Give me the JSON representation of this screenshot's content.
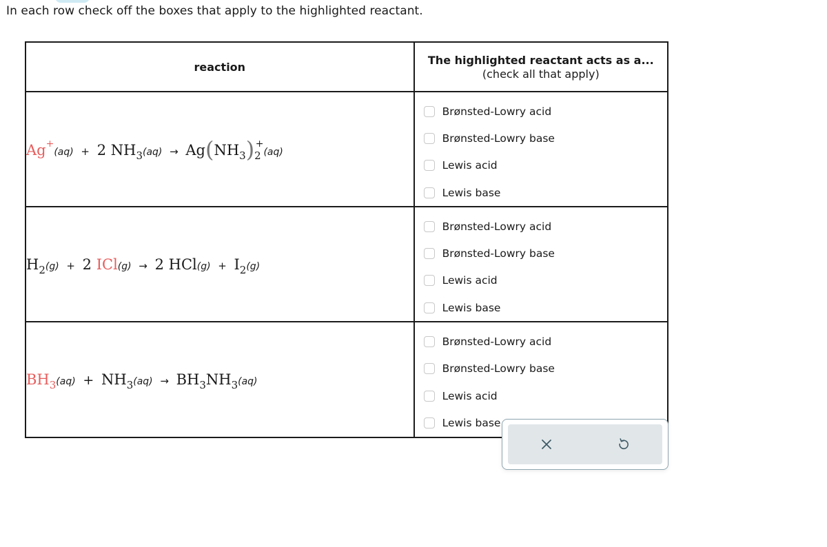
{
  "instructions": "In each row check off the boxes that apply to the highlighted reactant.",
  "table": {
    "headers": {
      "reaction": "reaction",
      "options_title": "The highlighted reactant acts as a...",
      "options_subtitle": "(check all that apply)"
    },
    "highlight_color": "#e85c5c",
    "rows": [
      {
        "equation": {
          "r1": "Ag",
          "r1_charge": "+",
          "r1_phase": "(aq)",
          "plus": "+",
          "r2_coef": "2",
          "r2": "NH",
          "r2_sub": "3",
          "r2_phase": "(aq)",
          "arrow": "→",
          "p1": "Ag",
          "p1_lparen": "(",
          "p1_inner": "NH",
          "p1_inner_sub": "3",
          "p1_rparen": ")",
          "p1_sub": "2",
          "p1_charge": "+",
          "p1_phase": "(aq)"
        },
        "highlighted": "Ag+",
        "options": [
          {
            "label": "Brønsted-Lowry acid",
            "checked": false
          },
          {
            "label": "Brønsted-Lowry base",
            "checked": false
          },
          {
            "label": "Lewis acid",
            "checked": false
          },
          {
            "label": "Lewis base",
            "checked": false
          }
        ]
      },
      {
        "equation": {
          "r1": "H",
          "r1_sub": "2",
          "r1_phase": "(g)",
          "plus": "+",
          "r2_coef": "2",
          "r2": "ICl",
          "r2_phase": "(g)",
          "arrow": "→",
          "p1_coef": "2",
          "p1": "HCl",
          "p1_phase": "(g)",
          "plus2": "+",
          "p2": "I",
          "p2_sub": "2",
          "p2_phase": "(g)"
        },
        "highlighted": "ICl",
        "options": [
          {
            "label": "Brønsted-Lowry acid",
            "checked": false
          },
          {
            "label": "Brønsted-Lowry base",
            "checked": false
          },
          {
            "label": "Lewis acid",
            "checked": false
          },
          {
            "label": "Lewis base",
            "checked": false
          }
        ]
      },
      {
        "equation": {
          "r1": "BH",
          "r1_sub": "3",
          "r1_phase": "(aq)",
          "plus": "+",
          "r2": "NH",
          "r2_sub": "3",
          "r2_phase": "(aq)",
          "arrow": "→",
          "p1a": "BH",
          "p1a_sub": "3",
          "p1b": "NH",
          "p1b_sub": "3",
          "p1_phase": "(aq)"
        },
        "highlighted": "BH3",
        "options": [
          {
            "label": "Brønsted-Lowry acid",
            "checked": false
          },
          {
            "label": "Brønsted-Lowry base",
            "checked": false
          },
          {
            "label": "Lewis acid",
            "checked": false
          },
          {
            "label": "Lewis base",
            "checked": false
          }
        ]
      }
    ]
  },
  "toolbar": {
    "clear_icon": "x-icon",
    "undo_icon": "undo-icon"
  }
}
